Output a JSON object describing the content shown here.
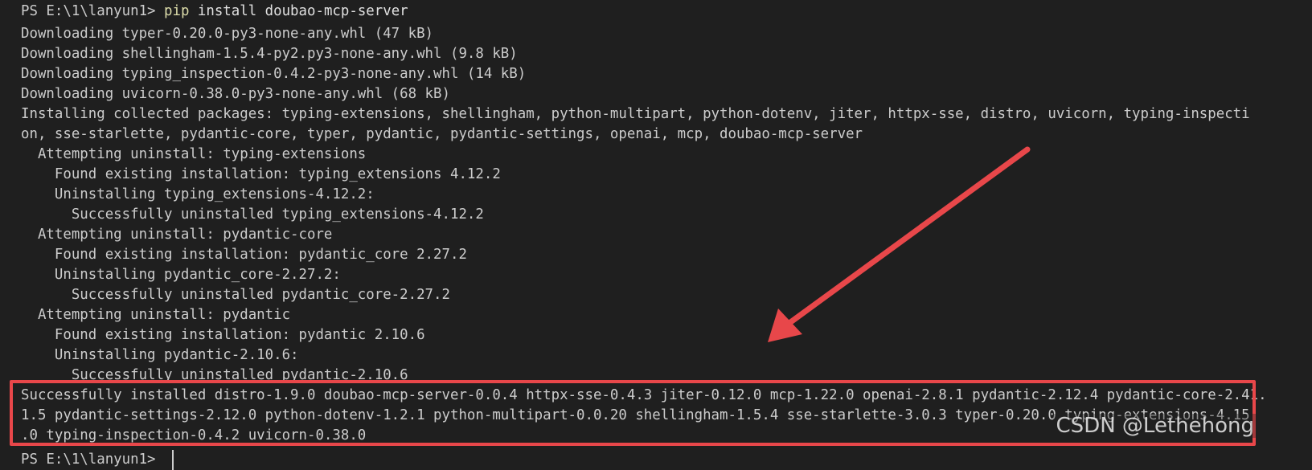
{
  "terminal": {
    "prompt": {
      "ps": "PS E:\\1\\lanyun1> ",
      "pip": "pip",
      "args": " install doubao-mcp-server"
    },
    "lines": [
      "Downloading typer-0.20.0-py3-none-any.whl (47 kB)",
      "Downloading shellingham-1.5.4-py2.py3-none-any.whl (9.8 kB)",
      "Downloading typing_inspection-0.4.2-py3-none-any.whl (14 kB)",
      "Downloading uvicorn-0.38.0-py3-none-any.whl (68 kB)",
      "Installing collected packages: typing-extensions, shellingham, python-multipart, python-dotenv, jiter, httpx-sse, distro, uvicorn, typing-inspecti",
      "on, sse-starlette, pydantic-core, typer, pydantic, pydantic-settings, openai, mcp, doubao-mcp-server",
      "  Attempting uninstall: typing-extensions",
      "    Found existing installation: typing_extensions 4.12.2",
      "    Uninstalling typing_extensions-4.12.2:",
      "      Successfully uninstalled typing_extensions-4.12.2",
      "  Attempting uninstall: pydantic-core",
      "    Found existing installation: pydantic_core 2.27.2",
      "    Uninstalling pydantic_core-2.27.2:",
      "      Successfully uninstalled pydantic_core-2.27.2",
      "  Attempting uninstall: pydantic",
      "    Found existing installation: pydantic 2.10.6",
      "    Uninstalling pydantic-2.10.6:",
      "      Successfully uninstalled pydantic-2.10.6",
      "Successfully installed distro-1.9.0 doubao-mcp-server-0.0.4 httpx-sse-0.4.3 jiter-0.12.0 mcp-1.22.0 openai-2.8.1 pydantic-2.12.4 pydantic-core-2.41.",
      "1.5 pydantic-settings-2.12.0 python-dotenv-1.2.1 python-multipart-0.0.20 shellingham-1.5.4 sse-starlette-3.0.3 typer-0.20.0 typing-extensions-4.15",
      ".0 typing-inspection-0.4.2 uvicorn-0.38.0"
    ],
    "next_prompt": "PS E:\\1\\lanyun1> "
  },
  "watermark": "CSDN @Lethehong",
  "colors": {
    "background": "#1f1f1f",
    "text": "#cccccc",
    "pip_command": "#dcdcaa",
    "annotation_red": "#e8474a"
  }
}
